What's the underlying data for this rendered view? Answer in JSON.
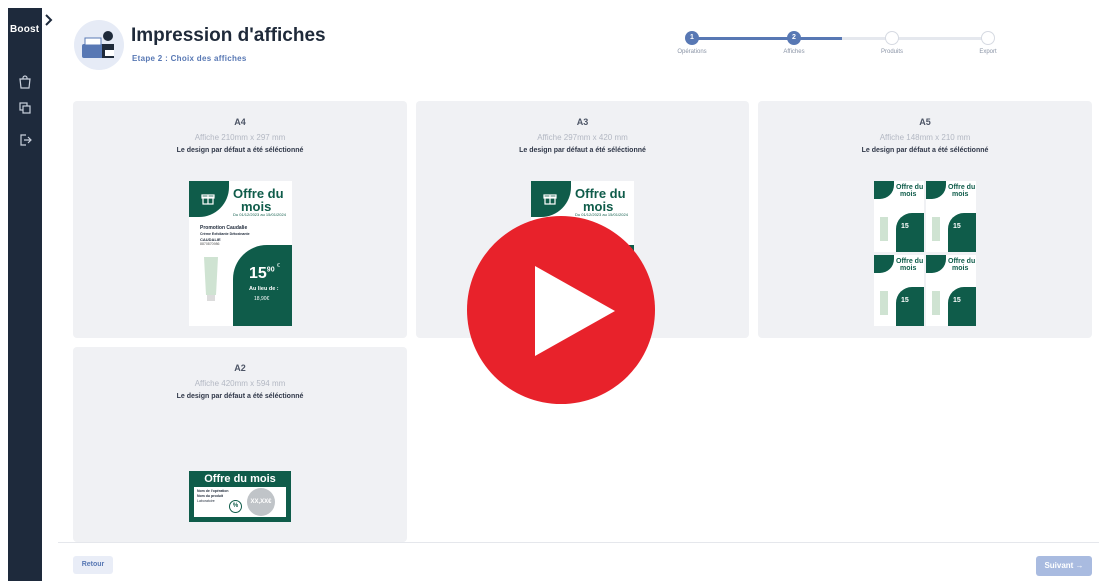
{
  "app": {
    "logo": "Boost"
  },
  "header": {
    "title": "Impression d'affiches",
    "subtitle": "Etape 2 : Choix des affiches"
  },
  "stepper": {
    "steps": [
      {
        "number": "1",
        "label": "Opérations",
        "status": "done"
      },
      {
        "number": "2",
        "label": "Affiches",
        "status": "current"
      },
      {
        "number": "",
        "label": "Produits",
        "status": "todo"
      },
      {
        "number": "",
        "label": "Export",
        "status": "todo"
      }
    ]
  },
  "formats": [
    {
      "name": "A4",
      "dimensions": "Affiche 210mm x 297 mm",
      "note": "Le design par défaut a été séléctionné"
    },
    {
      "name": "A3",
      "dimensions": "Affiche 297mm x 420 mm",
      "note": "Le design par défaut a été séléctionné"
    },
    {
      "name": "A5",
      "dimensions": "Affiche 148mm x 210 mm",
      "note": "Le design par défaut a été séléctionné"
    },
    {
      "name": "A2",
      "dimensions": "Affiche 420mm x 594 mm",
      "note": "Le design par défaut a été séléctionné"
    }
  ],
  "poster": {
    "headline": "Offre du mois",
    "headline_line1": "Offre du",
    "headline_line2": "mois",
    "date_range": "Du 01/12/2023 au 15/01/2024",
    "product_title": "Promotion Caudalie",
    "product_name": "Crème Exfoliante Détoxinante",
    "brand": "CAUDALIE",
    "ref": "8870870986",
    "price_main": "15",
    "price_cents": "90",
    "price_currency": "€",
    "instead_of_label": "Au lieu de :",
    "instead_of_price": "18,90€",
    "a2_line1": "Nom de l'opération",
    "a2_line2": "Nom du produit",
    "a2_line3": "Laboratoire",
    "a2_price": "XX,XX€",
    "a2_badge": "%"
  },
  "footer": {
    "back_label": "Retour",
    "next_label": "Suivant →"
  },
  "colors": {
    "sidebar": "#1e2a3c",
    "accent": "#5878b4",
    "poster_green": "#0f5c4a",
    "play_red": "#e8222b",
    "card_bg": "#f0f1f4"
  }
}
